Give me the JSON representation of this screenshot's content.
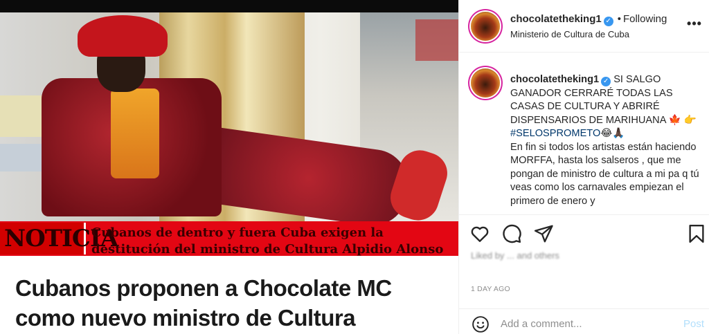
{
  "media": {
    "ticker_label": "NOTICIA",
    "ticker_line1": "Cubanos de dentro y fuera Cuba exigen la",
    "ticker_line2": "destitución del ministro de Cultura Alpidio Alonso",
    "headline": "Cubanos proponen a Chocolate MC como nuevo ministro de Cultura"
  },
  "header": {
    "username": "chocolatetheking1",
    "separator": "•",
    "follow_status": "Following",
    "location": "Ministerio de Cultura de Cuba",
    "more_icon": "more-horizontal-icon"
  },
  "caption": {
    "username": "chocolatetheking1",
    "text_main": "SI SALGO GANADOR CERRARÉ TODAS LAS CASAS DE CULTURA Y ABRIRÉ DISPENSARIOS DE MARIHUANA 🍁",
    "point_emoji": "👉",
    "hashtag": "#SELOSPROMETO",
    "hashtag_emojis": "😂🙏🏿",
    "text_body": "En fin si todos los artistas están haciendo MORFFA, hasta los salseros , que me pongan de ministro de cultura a mi pa q tú veas como los carnavales empiezan el primero de enero y"
  },
  "actions": {
    "icons": [
      "heart-icon",
      "comment-icon",
      "share-icon",
      "bookmark-icon"
    ],
    "liked_by": "Liked by ... and others",
    "time": "1 DAY AGO"
  },
  "comment": {
    "placeholder": "Add a comment...",
    "post_label": "Post"
  },
  "colors": {
    "ticker_red": "#e30613",
    "verified_blue": "#3897f0",
    "post_button_disabled": "#b2dffc",
    "hashtag_link": "#00376b"
  }
}
